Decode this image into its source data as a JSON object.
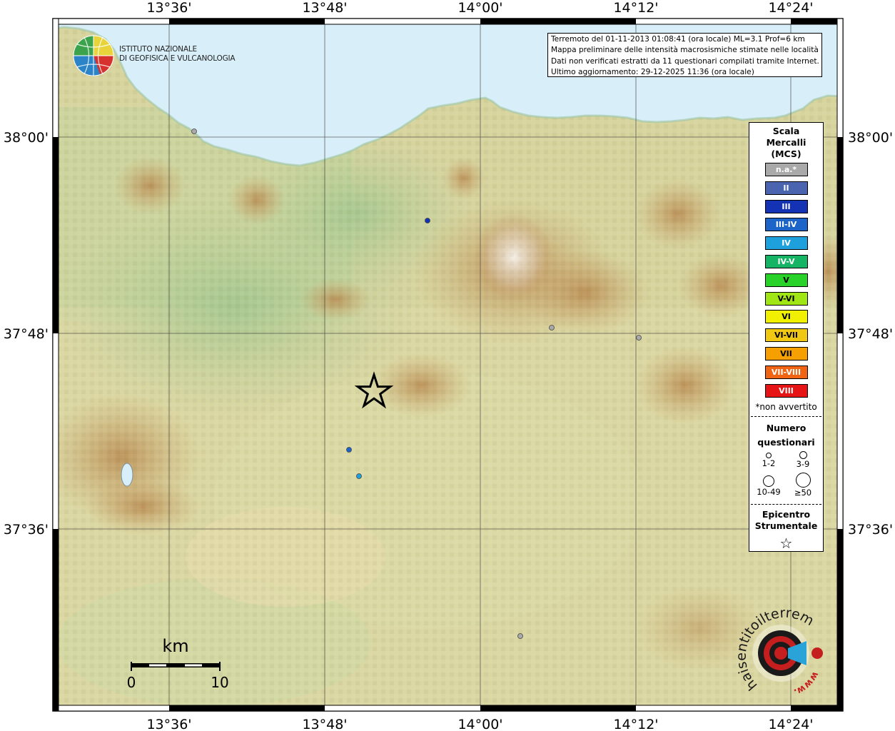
{
  "info": {
    "line1": "Terremoto del 01-11-2013 01:08:41 (ora locale) ML=3.1 Prof=6 km",
    "line2": "Mappa preliminare delle intensità macrosismiche stimate nelle località",
    "line3": "Dati non verificati estratti da 11 questionari compilati tramite Internet.",
    "line4": "Ultimo aggiornamento: 29-12-2025 11:36 (ora locale)"
  },
  "logo": {
    "line1": "ISTITUTO NAZIONALE",
    "line2": "DI GEOFISICA E VULCANOLOGIA"
  },
  "axes": {
    "longitudes": [
      "13°36'",
      "13°48'",
      "14°00'",
      "14°12'",
      "14°24'"
    ],
    "latitudes": [
      "38°00'",
      "37°48'",
      "37°36'"
    ]
  },
  "legend": {
    "title": "Scala Mercalli (MCS)",
    "title_lines": [
      "Scala",
      "Mercalli",
      "(MCS)"
    ],
    "items": [
      {
        "label": "n.a.*",
        "color": "#a9a9a9"
      },
      {
        "label": "II",
        "color": "#4a64b0"
      },
      {
        "label": "III",
        "color": "#1432b4"
      },
      {
        "label": "III-IV",
        "color": "#1c64c8"
      },
      {
        "label": "IV",
        "color": "#1ea0dc"
      },
      {
        "label": "IV-V",
        "color": "#14b464"
      },
      {
        "label": "V",
        "color": "#28d228"
      },
      {
        "label": "V-VI",
        "color": "#a0e614"
      },
      {
        "label": "VI",
        "color": "#f0f000"
      },
      {
        "label": "VI-VII",
        "color": "#f0c814"
      },
      {
        "label": "VII",
        "color": "#f5a000"
      },
      {
        "label": "VII-VIII",
        "color": "#f06414"
      },
      {
        "label": "VIII",
        "color": "#e61414"
      }
    ],
    "note": "*non avvertito",
    "questionnaires_title": "Numero questionari",
    "questionnaires_lines": [
      "Numero",
      "questionari"
    ],
    "sizes": [
      "1-2",
      "3-9",
      "10-49",
      "≥50"
    ],
    "epicenter_title": "Epicentro Strumentale",
    "epicenter_lines": [
      "Epicentro",
      "Strumentale"
    ],
    "epicenter_symbol": "☆"
  },
  "scale_bar": {
    "unit": "km",
    "min": "0",
    "max": "10"
  },
  "observations": [
    {
      "intensity": "III",
      "color": "#1432b4"
    },
    {
      "intensity": "III-IV",
      "color": "#1c64c8"
    },
    {
      "intensity": "IV",
      "color": "#1ea0dc"
    },
    {
      "intensity": "n.a.",
      "color": "#a9a9a9"
    },
    {
      "intensity": "n.a.",
      "color": "#a9a9a9"
    },
    {
      "intensity": "n.a.",
      "color": "#a9a9a9"
    },
    {
      "intensity": "n.a.",
      "color": "#a9a9a9"
    }
  ],
  "watermark": {
    "text": "haisentitoilterremoto.it",
    "url": "www."
  }
}
